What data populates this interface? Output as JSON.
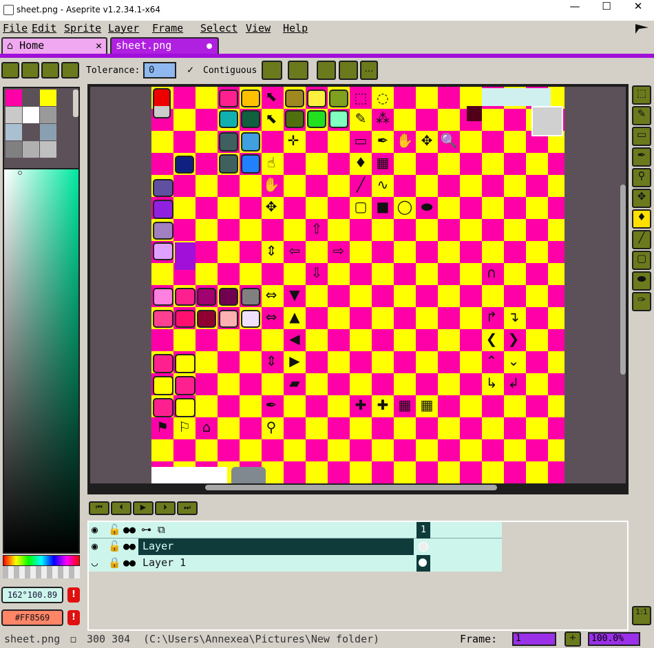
{
  "window": {
    "title": "sheet.png - Aseprite v1.2.34.1-x64",
    "minimize": "—",
    "maximize": "☐",
    "close": "✕"
  },
  "menu": [
    "File",
    "Edit",
    "Sprite",
    "Layer",
    "Frame",
    "Select",
    "View",
    "Help"
  ],
  "tabs": [
    {
      "label": "Home",
      "icon": "home-icon",
      "close": "✕"
    },
    {
      "label": "sheet.png",
      "icon": "modified-dot-icon"
    }
  ],
  "context_bar": {
    "tolerance_label": "Tolerance:",
    "tolerance_value": "0",
    "contiguous_label": "Contiguous",
    "contiguous_checked": true
  },
  "color_bar": {
    "fg_color_label": "162°100.89",
    "bg_color_label": "#FF8569",
    "warning_icon": "!"
  },
  "timeline": {
    "buttons": [
      "first-frame",
      "previous-frame",
      "play",
      "next-frame",
      "last-frame"
    ],
    "frame_header": "1",
    "layers": [
      {
        "name": "Layer",
        "selected": true
      },
      {
        "name": "Layer 1",
        "selected": false
      }
    ],
    "zoom_button": "1:1"
  },
  "status": {
    "file": "sheet.png",
    "size": "300 304",
    "path": "(C:\\Users\\Annexea\\Pictures\\New folder)",
    "frame_label": "Frame:",
    "frame_value": "1",
    "zoom_value": "100.0%"
  },
  "colors": {
    "accent": "#a010d8",
    "button": "#6b7a1d",
    "magenta": "#ff00a8",
    "yellow": "#ffff00",
    "timeline_row": "#cdf5ec",
    "timeline_selected": "#0f3b3b"
  }
}
